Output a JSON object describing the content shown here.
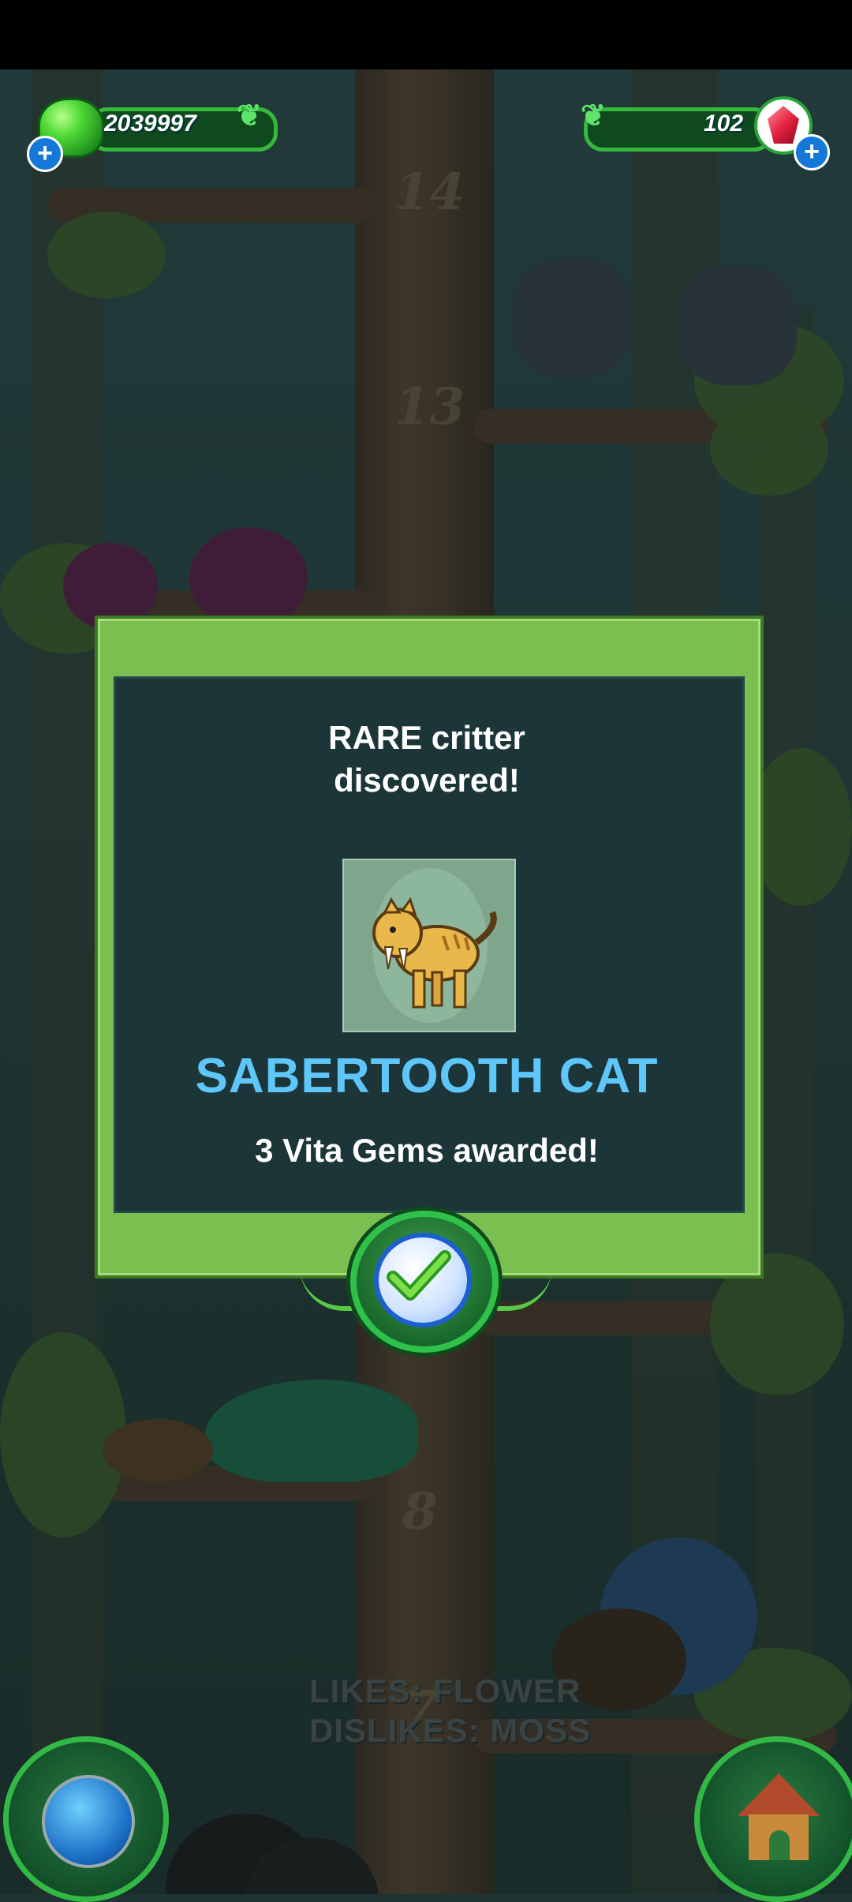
{
  "hud": {
    "green_currency": "2039997",
    "gem_currency": "102",
    "green_plus": "+",
    "gem_plus": "+"
  },
  "background": {
    "floor_numbers": [
      "14",
      "13",
      "8",
      "7"
    ],
    "likes_text": "LIKES: FLOWER",
    "dislikes_text": "DISLIKES: MOSS"
  },
  "dialog": {
    "title_line1": "RARE critter",
    "title_line2": "discovered!",
    "critter_name": "SABERTOOTH CAT",
    "reward_text": "3 Vita Gems awarded!"
  },
  "colors": {
    "panel_green": "#7cbf51",
    "panel_dark": "#1b3539",
    "name_blue": "#5ec6f8"
  },
  "icons": [
    "green-gem-icon",
    "red-gem-icon",
    "plus-icon",
    "checkmark-icon",
    "globe-icon",
    "house-icon",
    "sabertooth-cat-icon"
  ]
}
